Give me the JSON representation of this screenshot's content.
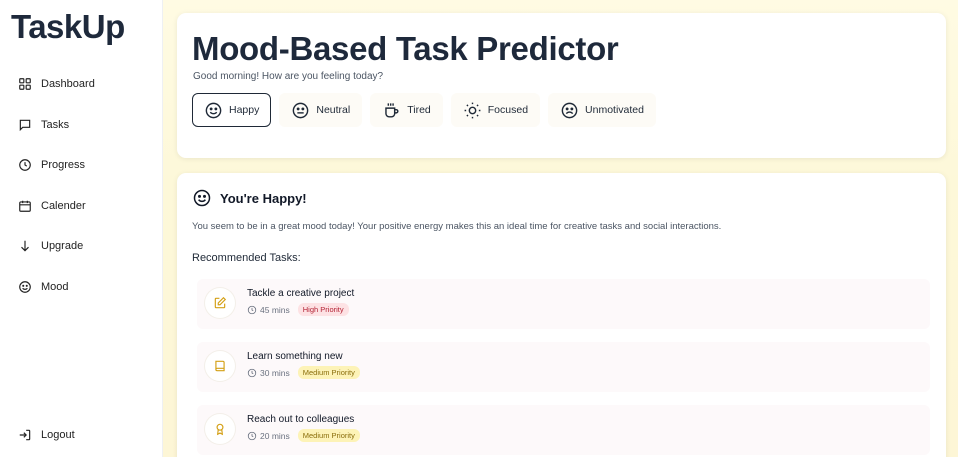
{
  "app": {
    "name": "TaskUp"
  },
  "sidebar": {
    "items": [
      {
        "label": "Dashboard",
        "icon": "grid-icon"
      },
      {
        "label": "Tasks",
        "icon": "chat-icon"
      },
      {
        "label": "Progress",
        "icon": "clock-icon"
      },
      {
        "label": "Calender",
        "icon": "calendar-icon"
      },
      {
        "label": "Upgrade",
        "icon": "arrow-down-icon"
      },
      {
        "label": "Mood",
        "icon": "smile-icon"
      }
    ],
    "logout": {
      "label": "Logout",
      "icon": "logout-icon"
    }
  },
  "header": {
    "title": "Mood-Based Task Predictor",
    "greeting": "Good morning! How are you feeling today?"
  },
  "moods": [
    {
      "label": "Happy",
      "icon": "smile-icon",
      "selected": true
    },
    {
      "label": "Neutral",
      "icon": "neutral-face-icon",
      "selected": false
    },
    {
      "label": "Tired",
      "icon": "coffee-cup-icon",
      "selected": false
    },
    {
      "label": "Focused",
      "icon": "sun-icon",
      "selected": false
    },
    {
      "label": "Unmotivated",
      "icon": "frown-icon",
      "selected": false
    }
  ],
  "result": {
    "title": "You're Happy!",
    "description": "You seem to be in a great mood today! Your positive energy makes this an ideal time for creative tasks and social interactions.",
    "recommended_label": "Recommended Tasks:",
    "tasks": [
      {
        "name": "Tackle a creative project",
        "duration": "45 mins",
        "priority": "High Priority",
        "icon": "edit-icon"
      },
      {
        "name": "Learn something new",
        "duration": "30 mins",
        "priority": "Medium Priority",
        "icon": "book-icon"
      },
      {
        "name": "Reach out to colleagues",
        "duration": "20 mins",
        "priority": "Medium Priority",
        "icon": "award-icon"
      }
    ]
  },
  "colors": {
    "accent_icon": "#d4a017",
    "background_gradient": "#fffbe3",
    "high_priority": "#fde2e4",
    "medium_priority": "#fdf3b7"
  }
}
